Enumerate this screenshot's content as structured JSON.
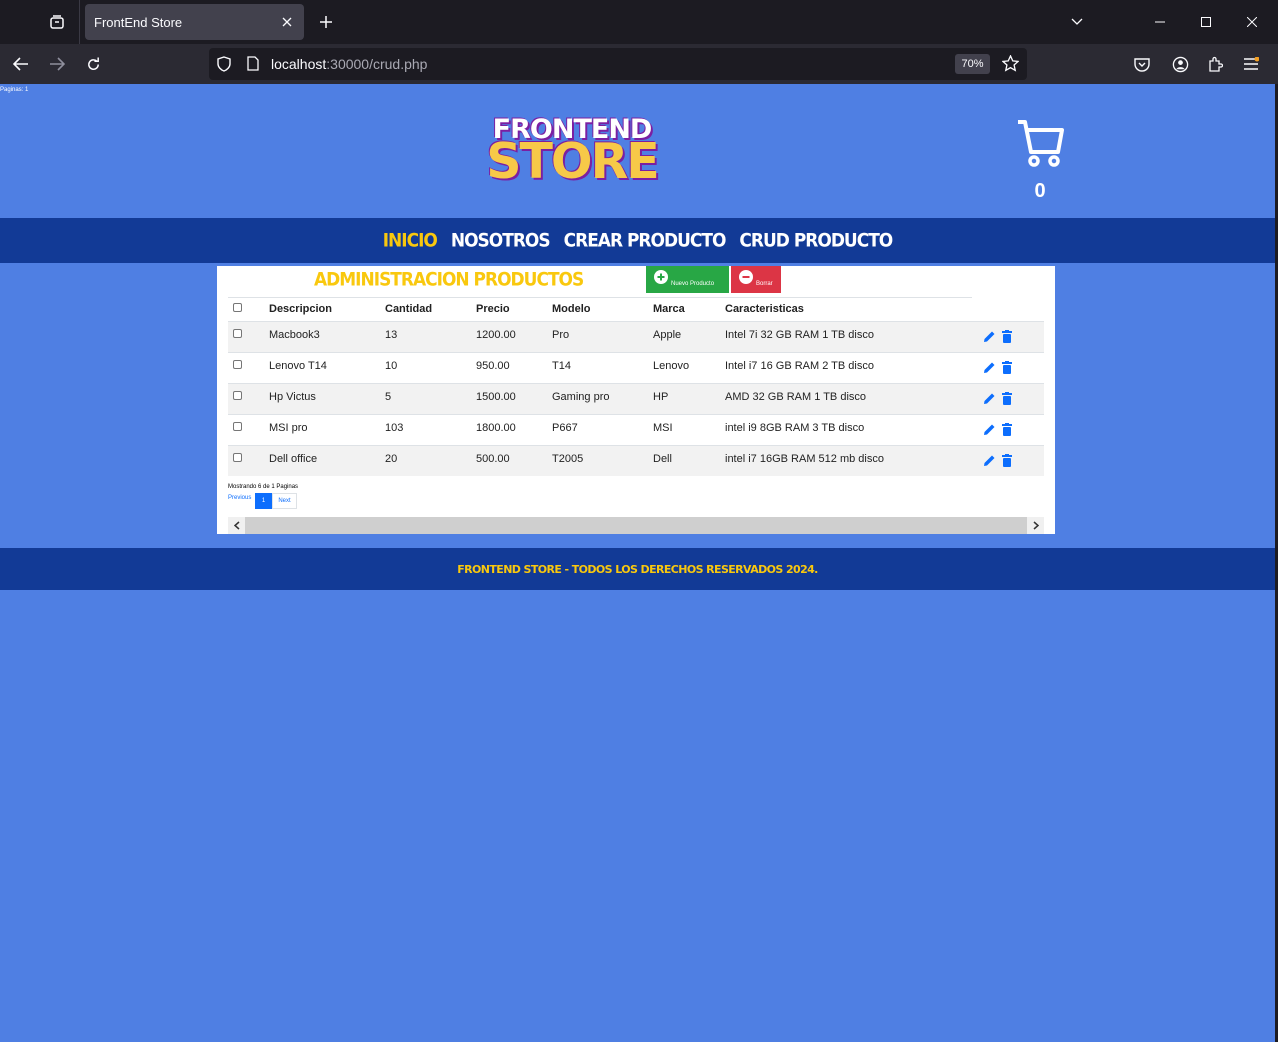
{
  "browser": {
    "tab_title": "FrontEnd Store",
    "url_host": "localhost",
    "url_rest": ":30000/crud.php",
    "zoom": "70%"
  },
  "page": {
    "debug_text": "Paginas: 1",
    "logo_line1": "FRONTEND",
    "logo_line2": "STORE",
    "cart_count": "0",
    "menu": [
      {
        "label": "INICIO",
        "active": true
      },
      {
        "label": "NOSOTROS",
        "active": false
      },
      {
        "label": "CREAR PRODUCTO",
        "active": false
      },
      {
        "label": "CRUD PRODUCTO",
        "active": false
      }
    ],
    "panel_title": "ADMINISTRACION PRODUCTOS",
    "btn_new": "Nuevo Producto",
    "btn_delete": "Borrar",
    "columns": [
      "Descripcion",
      "Cantidad",
      "Precio",
      "Modelo",
      "Marca",
      "Caracteristicas"
    ],
    "rows": [
      [
        "Macbook3",
        "13",
        "1200.00",
        "Pro",
        "Apple",
        "Intel 7i 32 GB RAM 1 TB disco"
      ],
      [
        "Lenovo T14",
        "10",
        "950.00",
        "T14",
        "Lenovo",
        "Intel i7 16 GB RAM 2 TB disco"
      ],
      [
        "Hp Victus",
        "5",
        "1500.00",
        "Gaming pro",
        "HP",
        "AMD 32 GB RAM 1 TB disco"
      ],
      [
        "MSI pro",
        "103",
        "1800.00",
        "P667",
        "MSI",
        "intel i9 8GB RAM 3 TB disco"
      ],
      [
        "Dell office",
        "20",
        "500.00",
        "T2005",
        "Dell",
        "intel i7 16GB RAM 512 mb disco"
      ]
    ],
    "info": "Mostrando 6 de 1 Paginas",
    "prev": "Previous",
    "page": "1",
    "next": "Next",
    "footer": "FRONTEND STORE - TODOS LOS DERECHOS RESERVADOS 2024.",
    "colors": {
      "accent": "#f9c80e",
      "nav": "#123a96",
      "bg": "#4f7fe3",
      "edit": "#0d6efd"
    }
  }
}
